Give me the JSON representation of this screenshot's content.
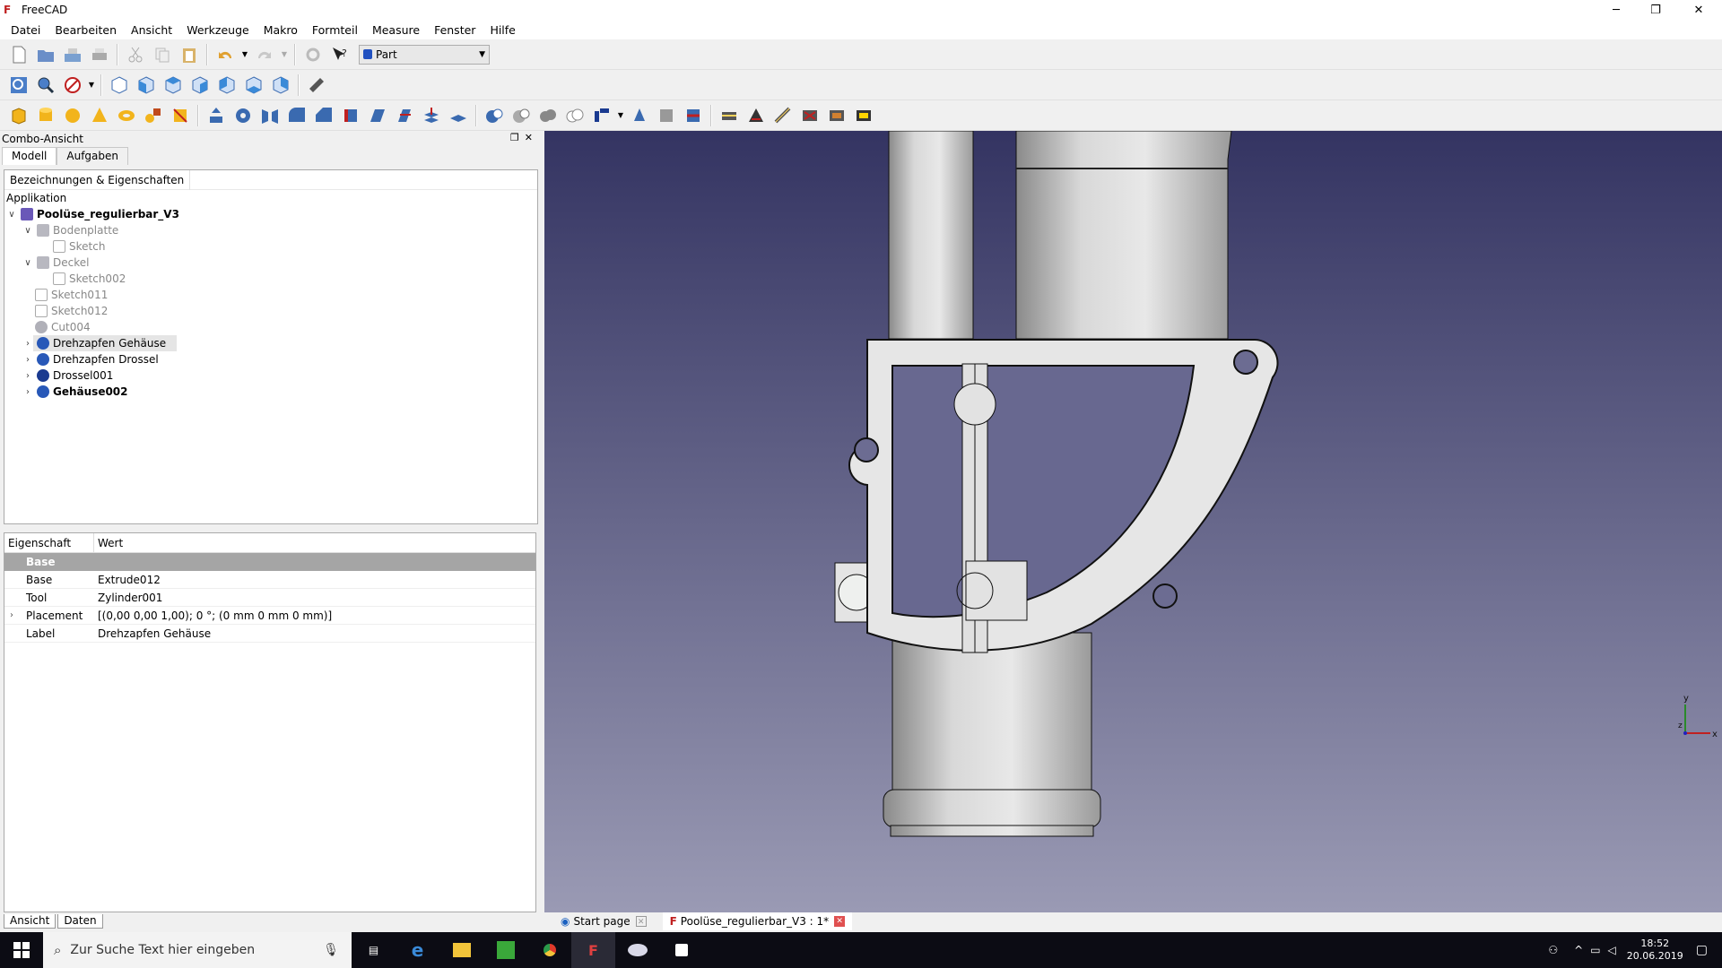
{
  "window": {
    "title": "FreeCAD",
    "app_icon": "freecad-icon"
  },
  "menu": [
    "Datei",
    "Bearbeiten",
    "Ansicht",
    "Werkzeuge",
    "Makro",
    "Formteil",
    "Measure",
    "Fenster",
    "Hilfe"
  ],
  "workbench": {
    "selected": "Part"
  },
  "combo": {
    "title": "Combo-Ansicht",
    "tabs": [
      "Modell",
      "Aufgaben"
    ],
    "active_tab": "Modell"
  },
  "tree": {
    "header": "Bezeichnungen & Eigenschaften",
    "section": "Applikation",
    "document": "Poolüse_regulierbar_V3",
    "items": [
      {
        "label": "Bodenplatte",
        "level": 1,
        "expanded": true,
        "muted": true
      },
      {
        "label": "Sketch",
        "level": 2,
        "muted": true
      },
      {
        "label": "Deckel",
        "level": 1,
        "expanded": true,
        "muted": true
      },
      {
        "label": "Sketch002",
        "level": 2,
        "muted": true
      },
      {
        "label": "Sketch011",
        "level": 1,
        "muted": true
      },
      {
        "label": "Sketch012",
        "level": 1,
        "muted": true
      },
      {
        "label": "Cut004",
        "level": 1,
        "muted": true
      },
      {
        "label": "Drehzapfen Gehäuse",
        "level": 1,
        "collapsed": true,
        "selected": true
      },
      {
        "label": "Drehzapfen Drossel",
        "level": 1,
        "collapsed": true
      },
      {
        "label": "Drossel001",
        "level": 1,
        "collapsed": true
      },
      {
        "label": "Gehäuse002",
        "level": 1,
        "collapsed": true,
        "bold": true
      }
    ]
  },
  "properties": {
    "col_property": "Eigenschaft",
    "col_value": "Wert",
    "group": "Base",
    "rows": [
      {
        "name": "Base",
        "value": "Extrude012"
      },
      {
        "name": "Tool",
        "value": "Zylinder001"
      },
      {
        "name": "Placement",
        "value": "[(0,00 0,00 1,00); 0 °; (0 mm  0 mm  0 mm)]",
        "expandable": true
      },
      {
        "name": "Label",
        "value": "Drehzapfen Gehäuse"
      }
    ]
  },
  "bottom_tabs": [
    "Ansicht",
    "Daten"
  ],
  "view_tabs": [
    {
      "label": "Start page"
    },
    {
      "label": "Poolüse_regulierbar_V3 : 1*",
      "active": true
    }
  ],
  "axis": {
    "x": "x",
    "y": "y",
    "z": "z"
  },
  "taskbar": {
    "search_placeholder": "Zur Suche Text hier eingeben",
    "time": "18:52",
    "date": "20.06.2019"
  },
  "colors": {
    "viewport_top": "#343462",
    "viewport_bottom": "#9a9ab4",
    "selected_row": "#e5e5e5",
    "group_bg": "#a5a5a5"
  }
}
